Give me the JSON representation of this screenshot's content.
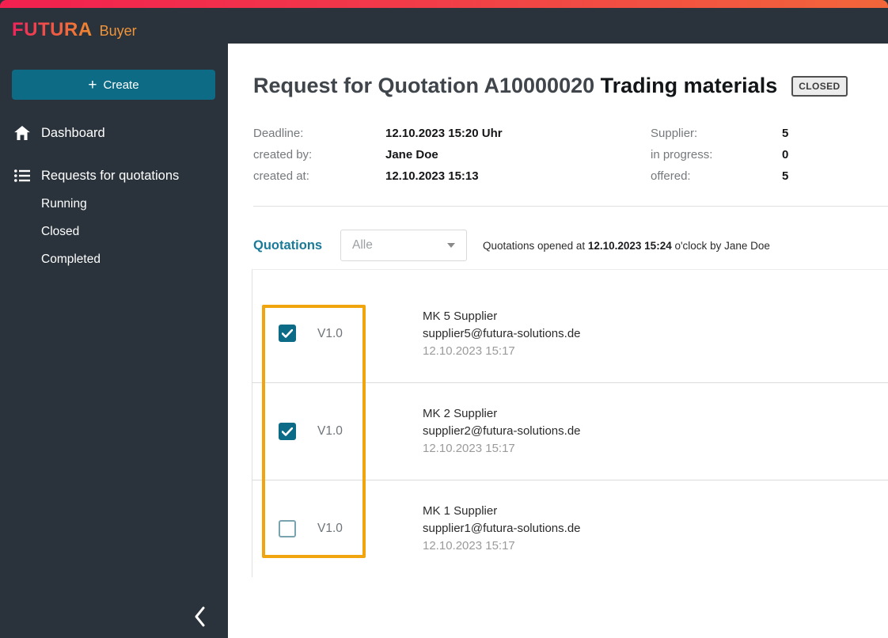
{
  "brand": {
    "name": "FUTURA",
    "product": "Buyer"
  },
  "sidebar": {
    "create_label": "Create",
    "items": [
      {
        "label": "Dashboard"
      },
      {
        "label": "Requests for quotations"
      }
    ],
    "subitems": [
      {
        "label": "Running"
      },
      {
        "label": "Closed"
      },
      {
        "label": "Completed"
      }
    ]
  },
  "header": {
    "title_prefix": "Request for Quotation A10000020 ",
    "title_name": "Trading materials",
    "status_badge": "CLOSED"
  },
  "details": {
    "left": [
      {
        "label": "Deadline:",
        "value": "12.10.2023 15:20 Uhr"
      },
      {
        "label": "created by:",
        "value": "Jane Doe"
      },
      {
        "label": "created at:",
        "value": "12.10.2023 15:13"
      }
    ],
    "right": [
      {
        "label": "Supplier:",
        "value": "5"
      },
      {
        "label": "in progress:",
        "value": "0"
      },
      {
        "label": "offered:",
        "value": "5"
      }
    ]
  },
  "quotations": {
    "section_label": "Quotations",
    "filter_value": "Alle",
    "opened_prefix": "Quotations opened at ",
    "opened_datetime": "12.10.2023 15:24",
    "opened_suffix": " o'clock by Jane Doe",
    "rows": [
      {
        "checked": true,
        "version": "V1.0",
        "name": "MK 5 Supplier",
        "email": "supplier5@futura-solutions.de",
        "date": "12.10.2023 15:17"
      },
      {
        "checked": true,
        "version": "V1.0",
        "name": "MK 2 Supplier",
        "email": "supplier2@futura-solutions.de",
        "date": "12.10.2023 15:17"
      },
      {
        "checked": false,
        "version": "V1.0",
        "name": "MK 1 Supplier",
        "email": "supplier1@futura-solutions.de",
        "date": "12.10.2023 15:17"
      }
    ]
  },
  "colors": {
    "accent_teal": "#0d6b86",
    "dark_header": "#2a333c",
    "highlight_orange": "#f0a40d",
    "gradient_left": "#f2204f",
    "gradient_right": "#f2663a"
  }
}
